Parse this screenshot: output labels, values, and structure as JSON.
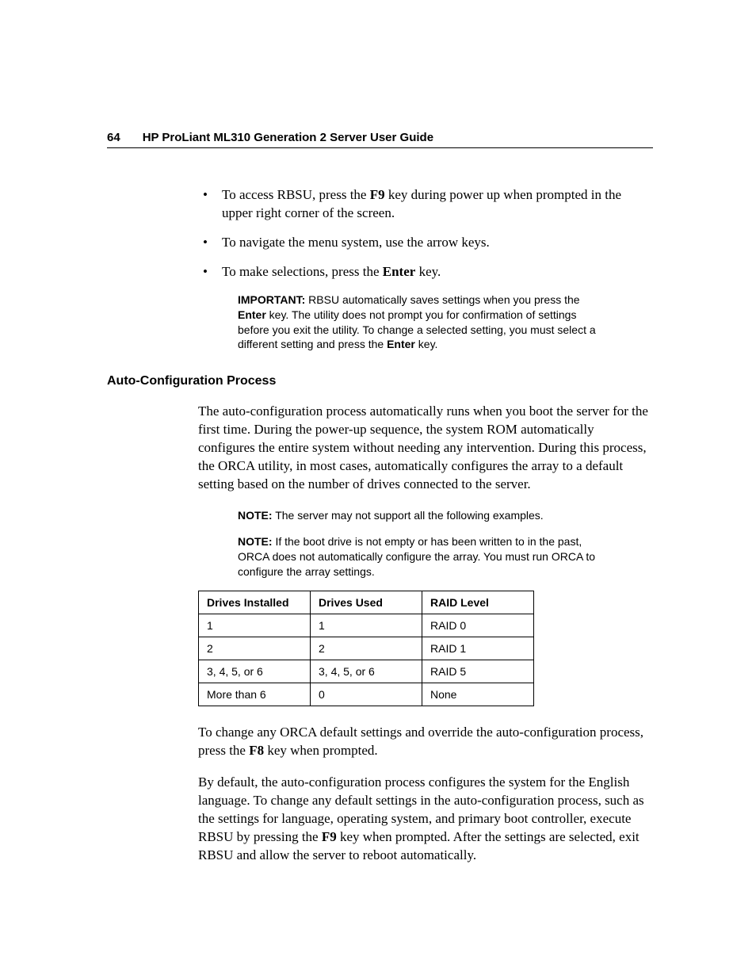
{
  "header": {
    "page_number": "64",
    "title": "HP ProLiant ML310 Generation 2 Server User Guide"
  },
  "bullets": {
    "b1_pre": "To access RBSU, press the ",
    "b1_key": "F9",
    "b1_post": " key during power up when prompted in the upper right corner of the screen.",
    "b2": "To navigate the menu system, use the arrow keys.",
    "b3_pre": "To make selections, press the ",
    "b3_key": "Enter",
    "b3_post": " key."
  },
  "important": {
    "label": "IMPORTANT:",
    "t1": "  RBSU automatically saves settings when you press the ",
    "key1": "Enter",
    "t2": " key. The utility does not prompt you for confirmation of settings before you exit the utility. To change a selected setting, you must select a different setting and press the ",
    "key2": "Enter",
    "t3": " key."
  },
  "section_heading": "Auto-Configuration Process",
  "para1": "The auto-configuration process automatically runs when you boot the server for the first time. During the power-up sequence, the system ROM automatically configures the entire system without needing any intervention. During this process, the ORCA utility, in most cases, automatically configures the array to a default setting based on the number of drives connected to the server.",
  "note1": {
    "label": "NOTE:",
    "text": "  The server may not support all the following examples."
  },
  "note2": {
    "label": "NOTE:",
    "text": "  If the boot drive is not empty or has been written to in the past, ORCA does not automatically configure the array. You must run ORCA to configure the array settings."
  },
  "table": {
    "headers": [
      "Drives Installed",
      "Drives Used",
      "RAID Level"
    ],
    "rows": [
      [
        "1",
        "1",
        "RAID 0"
      ],
      [
        "2",
        "2",
        "RAID 1"
      ],
      [
        "3, 4, 5, or 6",
        "3, 4, 5, or 6",
        "RAID 5"
      ],
      [
        "More than 6",
        "0",
        "None"
      ]
    ]
  },
  "para2_pre": "To change any ORCA default settings and override the auto-configuration process, press the ",
  "para2_key": "F8",
  "para2_post": " key when prompted.",
  "para3_pre": "By default, the auto-configuration process configures the system for the English language. To change any default settings in the auto-configuration process, such as the settings for language, operating system, and primary boot controller, execute RBSU by pressing the ",
  "para3_key": "F9",
  "para3_post": " key when prompted. After the settings are selected, exit RBSU and allow the server to reboot automatically."
}
